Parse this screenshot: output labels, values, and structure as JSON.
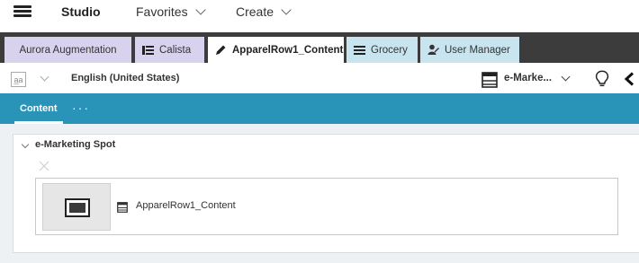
{
  "app": {
    "title": "Studio"
  },
  "menu": {
    "favorites": "Favorites",
    "create": "Create"
  },
  "tabs": [
    {
      "label": "Aurora Augmentation",
      "icon": "none"
    },
    {
      "label": "Calista",
      "icon": "list-icon"
    },
    {
      "label": "ApparelRow1_Content",
      "icon": "pencil-icon",
      "active": true,
      "close": "×"
    },
    {
      "label": "Grocery",
      "icon": "menu-lines-icon"
    },
    {
      "label": "User Manager",
      "icon": "user-manager-icon"
    }
  ],
  "toolbar": {
    "language_icon_text": "a̲a",
    "language": "English (United States)",
    "spot_type": "e-Marke..."
  },
  "content_band": {
    "tab_label": "Content",
    "more": "···"
  },
  "panel": {
    "title": "e-Marketing Spot",
    "item_label": "ApparelRow1_Content"
  },
  "colors": {
    "tab_purple": "#d8d2ee",
    "tab_blue": "#c7e4ef",
    "band": "#2a93b8",
    "tabstrip_bg": "#3c3c3c"
  }
}
